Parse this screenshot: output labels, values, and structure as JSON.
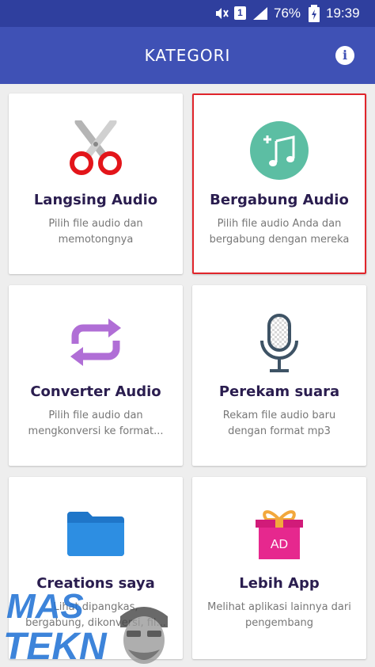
{
  "status_bar": {
    "sim": "1",
    "battery": "76%",
    "time": "19:39"
  },
  "app_bar": {
    "title": "KATEGORI",
    "info_icon": "info-icon",
    "info_label": "i"
  },
  "cards": [
    {
      "title": "Langsing Audio",
      "desc": [
        "Pilih file audio dan",
        "memotongnya"
      ],
      "icon": "scissors-icon",
      "selected": false
    },
    {
      "title": "Bergabung Audio",
      "desc": [
        "Pilih file audio Anda dan",
        "bergabung dengan mereka"
      ],
      "icon": "music-add-icon",
      "selected": true
    },
    {
      "title": "Converter Audio",
      "desc": [
        "Pilih file audio dan",
        "mengkonversi ke format..."
      ],
      "icon": "convert-icon",
      "selected": false
    },
    {
      "title": "Perekam suara",
      "desc": [
        "Rekam file audio baru",
        "dengan format mp3"
      ],
      "icon": "microphone-icon",
      "selected": false
    },
    {
      "title": "Creations saya",
      "desc": [
        "Lihat dipangkas,",
        "bergabung, dikonversi, fil..."
      ],
      "icon": "folder-icon",
      "selected": false
    },
    {
      "title": "Lebih App",
      "desc": [
        "Melihat aplikasi lainnya dari",
        "pengembang"
      ],
      "icon": "gift-icon",
      "gift_label": "AD",
      "selected": false
    }
  ],
  "watermark": {
    "line1": "MAS",
    "line2": "TEKN"
  },
  "colors": {
    "status_bar": "#2f3f9e",
    "app_bar": "#3f51b5",
    "selection_border": "#e0252b",
    "title_text": "#2a1d4f"
  }
}
